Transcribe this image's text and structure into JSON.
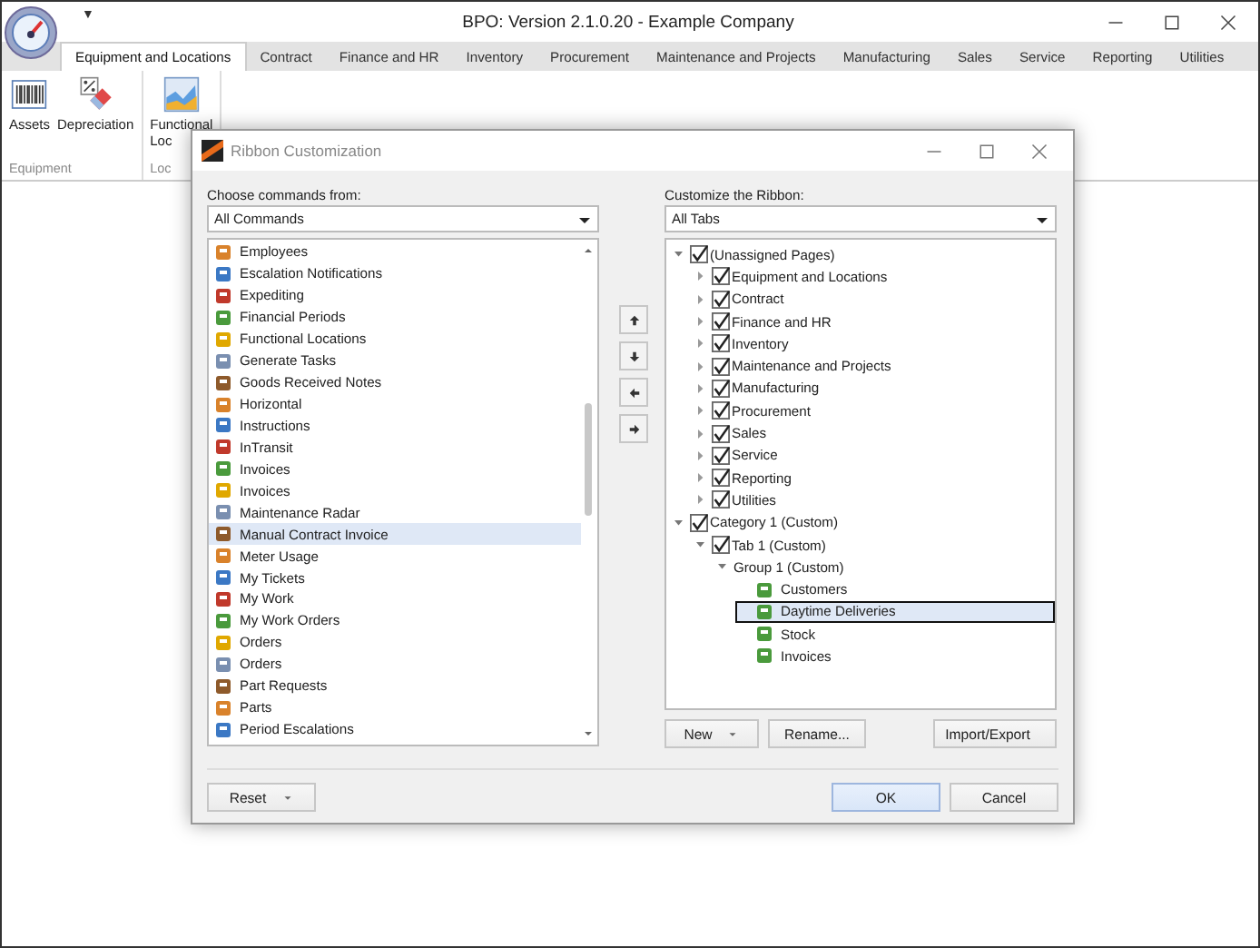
{
  "window": {
    "title": "BPO: Version 2.1.0.20 - Example Company",
    "quick_access": "▼"
  },
  "tabs": [
    {
      "label": "Equipment and Locations",
      "selected": true
    },
    {
      "label": "Contract",
      "selected": false
    },
    {
      "label": "Finance and HR",
      "selected": false
    },
    {
      "label": "Inventory",
      "selected": false
    },
    {
      "label": "Procurement",
      "selected": false
    },
    {
      "label": "Maintenance and Projects",
      "selected": false
    },
    {
      "label": "Manufacturing",
      "selected": false
    },
    {
      "label": "Sales",
      "selected": false
    },
    {
      "label": "Service",
      "selected": false
    },
    {
      "label": "Reporting",
      "selected": false
    },
    {
      "label": "Utilities",
      "selected": false
    }
  ],
  "ribbon": {
    "groups": [
      {
        "label": "Equipment",
        "buttons": [
          {
            "label": "Assets",
            "kind": "barcode"
          },
          {
            "label": "Depreciation",
            "kind": "percent"
          }
        ]
      },
      {
        "label": "Loc",
        "buttons": [
          {
            "label": "Functional Loc",
            "kind": "chart"
          }
        ]
      }
    ]
  },
  "dialog": {
    "title": "Ribbon Customization",
    "left": {
      "label": "Choose commands from:",
      "combo": "All Commands",
      "items": [
        {
          "label": "Employees",
          "selected": false
        },
        {
          "label": "Escalation Notifications",
          "selected": false
        },
        {
          "label": "Expediting",
          "selected": false
        },
        {
          "label": "Financial Periods",
          "selected": false
        },
        {
          "label": "Functional Locations",
          "selected": false
        },
        {
          "label": "Generate Tasks",
          "selected": false
        },
        {
          "label": "Goods Received Notes",
          "selected": false
        },
        {
          "label": "Horizontal",
          "selected": false
        },
        {
          "label": "Instructions",
          "selected": false
        },
        {
          "label": "InTransit",
          "selected": false
        },
        {
          "label": "Invoices",
          "selected": false
        },
        {
          "label": "Invoices",
          "selected": false
        },
        {
          "label": "Maintenance Radar",
          "selected": false
        },
        {
          "label": "Manual Contract Invoice",
          "selected": true
        },
        {
          "label": "Meter Usage",
          "selected": false
        },
        {
          "label": "My Tickets",
          "selected": false
        },
        {
          "label": "My Work",
          "selected": false
        },
        {
          "label": "My Work Orders",
          "selected": false
        },
        {
          "label": "Orders",
          "selected": false
        },
        {
          "label": "Orders",
          "selected": false
        },
        {
          "label": "Part Requests",
          "selected": false
        },
        {
          "label": "Parts",
          "selected": false
        },
        {
          "label": "Period Escalations",
          "selected": false
        }
      ]
    },
    "right": {
      "label": "Customize the Ribbon:",
      "combo": "All Tabs",
      "tree": [
        {
          "label": "(Unassigned Pages)",
          "kind": "node",
          "checked": true,
          "expanded": true,
          "children": [
            {
              "label": "Equipment and Locations",
              "kind": "node",
              "checked": true,
              "expanded": false
            },
            {
              "label": "Contract",
              "kind": "node",
              "checked": true,
              "expanded": false
            },
            {
              "label": "Finance and HR",
              "kind": "node",
              "checked": true,
              "expanded": false
            },
            {
              "label": "Inventory",
              "kind": "node",
              "checked": true,
              "expanded": false
            },
            {
              "label": "Maintenance and Projects",
              "kind": "node",
              "checked": true,
              "expanded": false
            },
            {
              "label": "Manufacturing",
              "kind": "node",
              "checked": true,
              "expanded": false
            },
            {
              "label": "Procurement",
              "kind": "node",
              "checked": true,
              "expanded": false
            },
            {
              "label": "Sales",
              "kind": "node",
              "checked": true,
              "expanded": false
            },
            {
              "label": "Service",
              "kind": "node",
              "checked": true,
              "expanded": false
            },
            {
              "label": "Reporting",
              "kind": "node",
              "checked": true,
              "expanded": false
            },
            {
              "label": "Utilities",
              "kind": "node",
              "checked": true,
              "expanded": false
            }
          ]
        },
        {
          "label": "Category 1 (Custom)",
          "kind": "node",
          "checked": true,
          "expanded": true,
          "children": [
            {
              "label": "Tab 1 (Custom)",
              "kind": "node",
              "checked": true,
              "expanded": true,
              "children": [
                {
                  "label": "Group 1 (Custom)",
                  "kind": "group",
                  "expanded": true,
                  "children": [
                    {
                      "label": "Customers",
                      "kind": "command",
                      "selected": false
                    },
                    {
                      "label": "Daytime Deliveries",
                      "kind": "command",
                      "selected": true
                    },
                    {
                      "label": "Stock",
                      "kind": "command",
                      "selected": false
                    },
                    {
                      "label": "Invoices",
                      "kind": "command",
                      "selected": false
                    }
                  ]
                }
              ]
            }
          ]
        }
      ],
      "buttons": [
        "New",
        "Rename...",
        "Import/Export"
      ]
    },
    "footer": {
      "reset": "Reset",
      "ok": "OK",
      "cancel": "Cancel"
    }
  }
}
